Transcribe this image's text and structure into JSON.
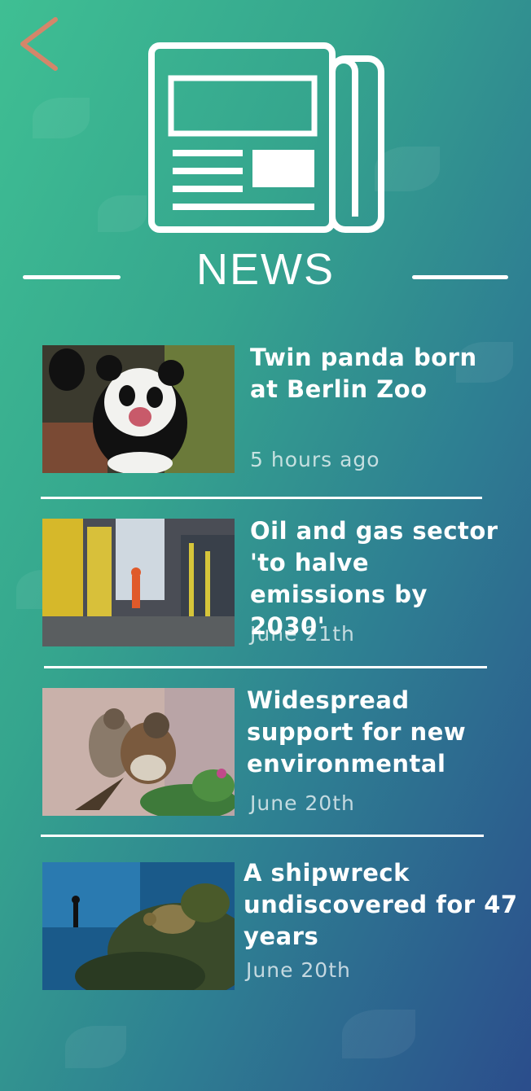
{
  "header": {
    "title": "NEWS",
    "back_icon": "chevron-left-icon",
    "hero_icon": "newspaper-icon",
    "colors": {
      "back_icon": "#d4866a"
    }
  },
  "articles": [
    {
      "title": "Twin panda born at Berlin Zoo",
      "date": "5 hours ago",
      "image": "panda-photo"
    },
    {
      "title": "Oil and gas sector 'to halve emissions by 2030'",
      "date": "June 21th",
      "image": "industrial-plant-photo"
    },
    {
      "title": "Widespread support for new environmental",
      "date": "June 20th",
      "image": "sparrows-photo"
    },
    {
      "title": "A shipwreck undiscovered for 47 years",
      "date": "June 20th",
      "image": "sea-turtle-photo"
    }
  ]
}
